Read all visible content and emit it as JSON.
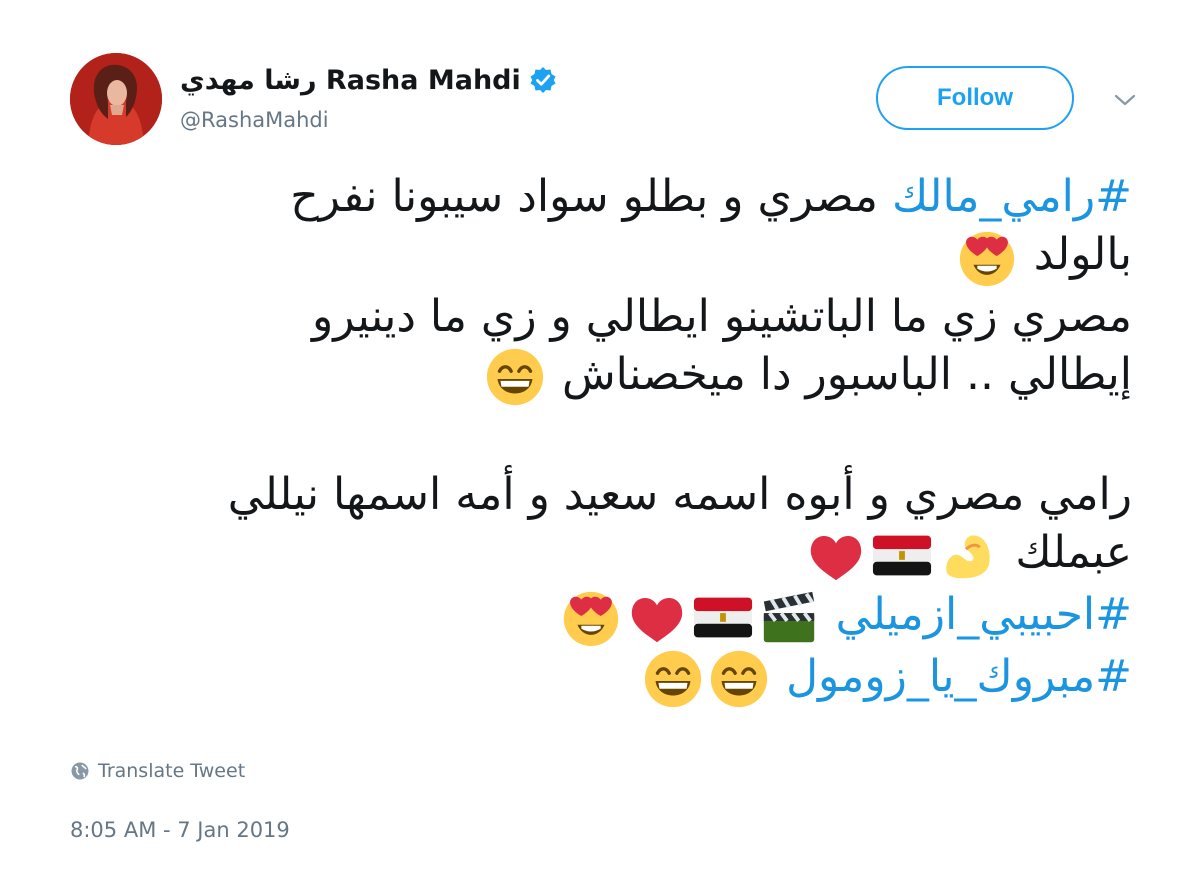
{
  "user": {
    "display_name": "رشا مهدي Rasha Mahdi",
    "handle": "@RashaMahdi",
    "verified": true
  },
  "actions": {
    "follow_label": "Follow"
  },
  "tweet": {
    "hashtag1": "#رامي_مالك",
    "line1_text": " مصري و بطلو سواد سيبونا نفرح",
    "line2_text": "بالولد",
    "line3_text": "مصري زي ما الباتشينو ايطالي و زي ما دينيرو",
    "line4_text": "إيطالي .. الباسبور دا ميخصناش",
    "line5_text": "رامي مصري و أبوه اسمه سعيد و أمه اسمها نيللي",
    "line6_text": "عبملك",
    "hashtag2": "#احبيبي_ازميلي",
    "hashtag3": "#مبروك_يا_زومول",
    "emojis": [
      "heart-eyes",
      "grinning",
      "flexed-bicep",
      "egypt-flag",
      "red-heart",
      "clapper-board",
      "egypt-flag",
      "red-heart",
      "heart-eyes",
      "grinning",
      "grinning"
    ]
  },
  "footer": {
    "translate_label": "Translate Tweet",
    "timestamp": "8:05 AM - 7 Jan 2019"
  },
  "colors": {
    "accent": "#1da1f2",
    "hashtag": "#1b95e0",
    "secondary_text": "#657786"
  }
}
